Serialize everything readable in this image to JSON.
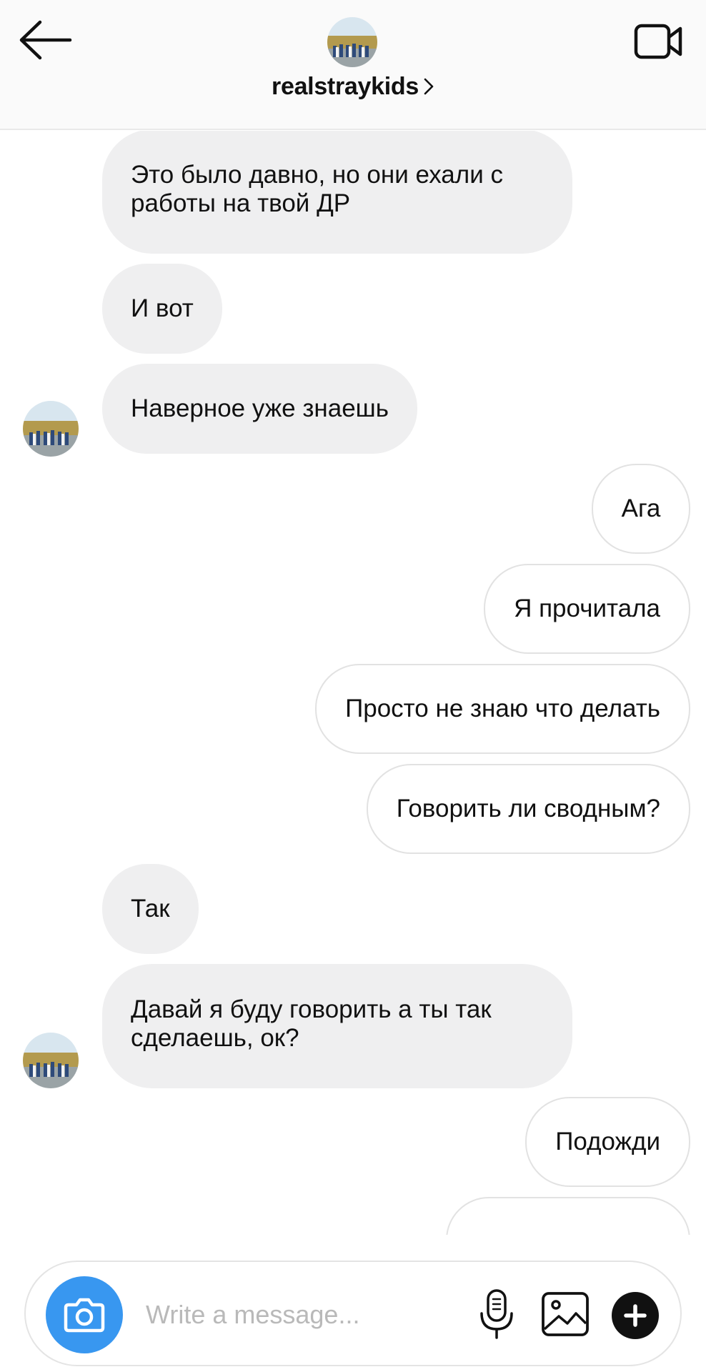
{
  "header": {
    "username": "realstraykids",
    "chevron": "chevron-right-icon",
    "back_icon": "arrow-left-icon",
    "video_icon": "video-camera-icon"
  },
  "messages": [
    {
      "side": "in",
      "text": "Это было давно, но они ехали с работы на твой ДР",
      "avatar": false
    },
    {
      "side": "in",
      "text": "И вот",
      "avatar": false
    },
    {
      "side": "in",
      "text": "Наверное уже знаешь",
      "avatar": true
    },
    {
      "side": "out",
      "text": "Ага"
    },
    {
      "side": "out",
      "text": "Я прочитала"
    },
    {
      "side": "out",
      "text": "Просто не знаю что делать"
    },
    {
      "side": "out",
      "text": "Говорить ли сводным?"
    },
    {
      "side": "in",
      "text": "Так",
      "avatar": false
    },
    {
      "side": "in",
      "text": "Давай я буду говорить а ты так сделаешь, ок?",
      "avatar": true
    },
    {
      "side": "out",
      "text": "Подожди"
    },
    {
      "side": "out",
      "text": "–"
    }
  ],
  "composer": {
    "placeholder": "Write a message...",
    "camera_icon": "camera-icon",
    "mic_icon": "microphone-icon",
    "gallery_icon": "image-gallery-icon",
    "add_icon": "plus-circle-icon"
  },
  "colors": {
    "incoming_bubble": "#efeff0",
    "outgoing_border": "#e2e2e2",
    "camera_button": "#3897f0",
    "header_bg": "#fafafa"
  }
}
